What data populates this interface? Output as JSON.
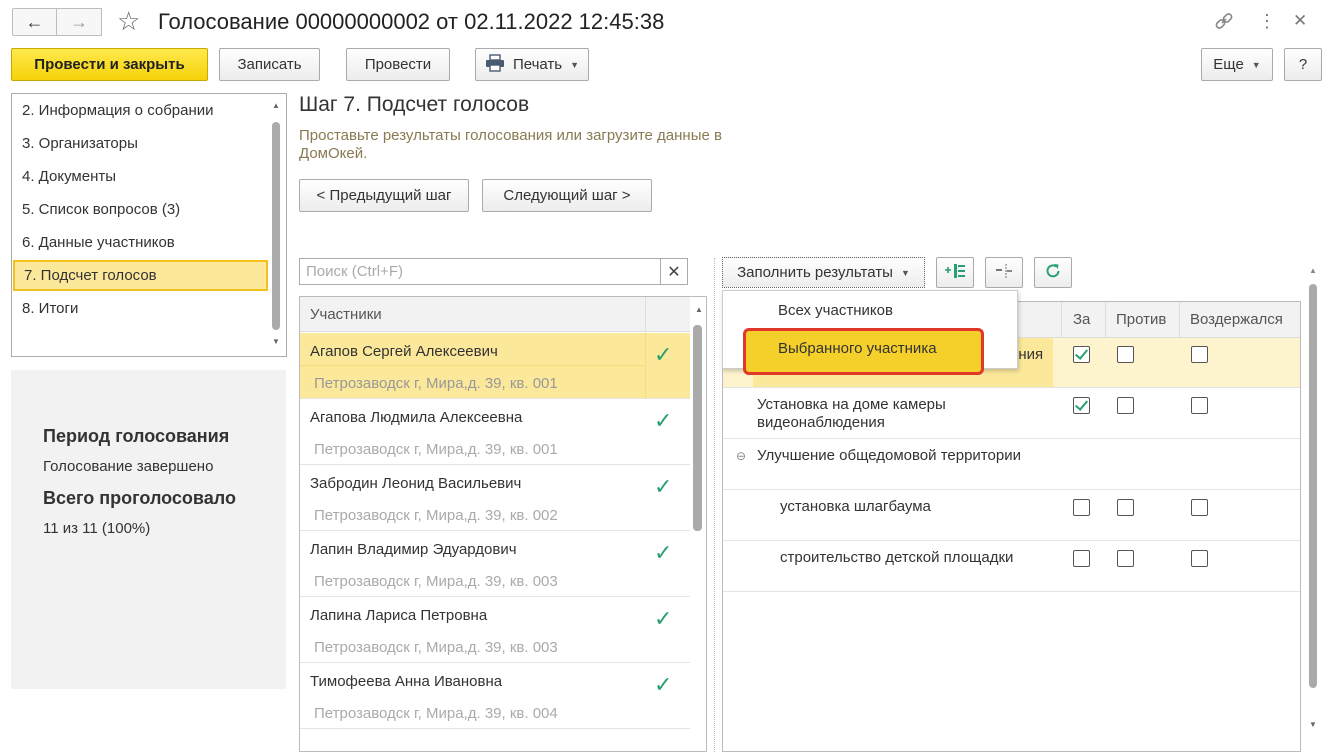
{
  "window": {
    "title": "Голосование 00000000002 от 02.11.2022 12:45:38"
  },
  "toolbar": {
    "post_close": "Провести и закрыть",
    "save": "Записать",
    "post": "Провести",
    "print": "Печать",
    "more": "Еще",
    "help": "?"
  },
  "nav": {
    "items": [
      "2. Информация о собрании",
      "3. Организаторы",
      "4. Документы",
      "5. Список вопросов (3)",
      "6. Данные участников",
      "7. Подсчет голосов",
      "8. Итоги"
    ],
    "selected_index": 5
  },
  "summary": {
    "period_heading": "Период голосования",
    "period_status": "Голосование завершено",
    "total_heading": "Всего проголосовало",
    "total_value": "11 из 11 (100%)"
  },
  "step": {
    "title": "Шаг 7. Подсчет голосов",
    "description": "Проставьте результаты голосования или загрузите данные в ДомОкей.",
    "prev": "< Предыдущий шаг",
    "next": "Следующий шаг >"
  },
  "search": {
    "placeholder": "Поиск (Ctrl+F)"
  },
  "participants": {
    "header": "Участники",
    "rows": [
      {
        "name": "Агапов Сергей Алексеевич",
        "address": "Петрозаводск г, Мира,д. 39, кв. 001",
        "voted": true,
        "selected": true
      },
      {
        "name": "Агапова Людмила Алексеевна",
        "address": "Петрозаводск г, Мира,д. 39, кв. 001",
        "voted": true,
        "selected": false
      },
      {
        "name": "Забродин Леонид Васильевич",
        "address": "Петрозаводск г, Мира,д. 39, кв. 002",
        "voted": true,
        "selected": false
      },
      {
        "name": "Лапин Владимир Эдуардович",
        "address": "Петрозаводск г, Мира,д. 39, кв. 003",
        "voted": true,
        "selected": false
      },
      {
        "name": "Лапина Лариса Петровна",
        "address": "Петрозаводск г, Мира,д. 39, кв. 003",
        "voted": true,
        "selected": false
      },
      {
        "name": "Тимофеева Анна Ивановна",
        "address": "Петрозаводск г, Мира,д. 39, кв. 004",
        "voted": true,
        "selected": false
      }
    ]
  },
  "results": {
    "fill_button": "Заполнить результаты",
    "columns": {
      "for": "За",
      "against": "Против",
      "abstain": "Воздержался"
    },
    "rows": [
      {
        "text": "ения",
        "for": true,
        "against": false,
        "abstain": false,
        "selected": true
      },
      {
        "text": "Установка на доме камеры видеонаблюдения",
        "for": true,
        "against": false,
        "abstain": false,
        "selected": false
      },
      {
        "text": "Улучшение общедомовой территории",
        "group": true
      },
      {
        "text": "установка шлагбаума",
        "for": false,
        "against": false,
        "abstain": false,
        "selected": false
      },
      {
        "text": "строительство детской площадки",
        "for": false,
        "against": false,
        "abstain": false,
        "selected": false
      }
    ]
  },
  "dropdown": {
    "all": "Всех участников",
    "selected": "Выбранного участника"
  },
  "colors": {
    "accent_yellow": "#f5d20a",
    "selection": "#fce89a",
    "check_green": "#2aa070",
    "highlight_red": "#e0392b"
  }
}
